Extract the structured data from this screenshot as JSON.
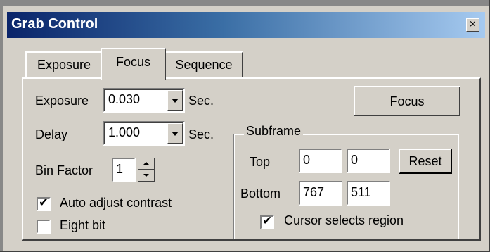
{
  "window": {
    "title": "Grab Control",
    "close_symbol": "×"
  },
  "tabs": [
    {
      "label": "Exposure",
      "active": false
    },
    {
      "label": "Focus",
      "active": true
    },
    {
      "label": "Sequence",
      "active": false
    }
  ],
  "focus_tab": {
    "exposure": {
      "label": "Exposure",
      "value": "0.030",
      "unit": "Sec."
    },
    "delay": {
      "label": "Delay",
      "value": "1.000",
      "unit": "Sec."
    },
    "bin_factor": {
      "label": "Bin Factor",
      "value": "1"
    },
    "auto_adjust": {
      "label": "Auto adjust contrast",
      "checked": true
    },
    "eight_bit": {
      "label": "Eight bit",
      "checked": false
    },
    "focus_button": "Focus",
    "subframe": {
      "label": "Subframe",
      "top_label": "Top",
      "top_values": [
        "0",
        "0"
      ],
      "bottom_label": "Bottom",
      "bottom_values": [
        "767",
        "511"
      ],
      "reset_button": "Reset",
      "cursor_selects": {
        "label": "Cursor selects region",
        "checked": true
      }
    }
  },
  "check_symbol": "✔"
}
